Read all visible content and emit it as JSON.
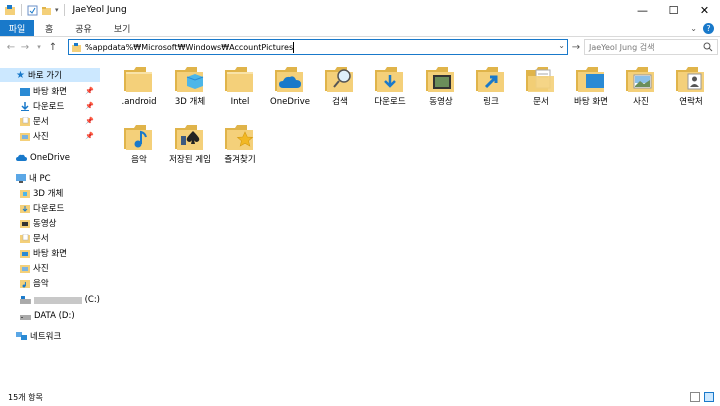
{
  "window": {
    "title": "JaeYeol Jung",
    "minimize": "—",
    "maximize": "☐",
    "close": "✕"
  },
  "ribbon": {
    "tabs": [
      "파일",
      "홈",
      "공유",
      "보기"
    ]
  },
  "address": {
    "path": "%appdata%₩Microsoft₩Windows₩AccountPictures",
    "search_placeholder": "JaeYeol Jung 검색"
  },
  "nav": {
    "quick_access": "바로 가기",
    "quick_items": [
      "바탕 화면",
      "다운로드",
      "문서",
      "사진"
    ],
    "onedrive": "OneDrive",
    "this_pc": "내 PC",
    "pc_items": [
      "3D 개체",
      "다운로드",
      "동영상",
      "문서",
      "바탕 화면",
      "사진",
      "음악"
    ],
    "drive_c": "(C:)",
    "drive_d": "DATA (D:)",
    "network": "네트워크"
  },
  "files": [
    {
      "name": ".android",
      "icon": "folder"
    },
    {
      "name": "3D 개체",
      "icon": "folder-3d"
    },
    {
      "name": "Intel",
      "icon": "folder"
    },
    {
      "name": "OneDrive",
      "icon": "onedrive-folder"
    },
    {
      "name": "검색",
      "icon": "search-folder"
    },
    {
      "name": "다운로드",
      "icon": "downloads-folder"
    },
    {
      "name": "동영상",
      "icon": "videos-folder"
    },
    {
      "name": "링크",
      "icon": "links-folder"
    },
    {
      "name": "문서",
      "icon": "documents-folder"
    },
    {
      "name": "바탕 화면",
      "icon": "desktop-folder"
    },
    {
      "name": "사진",
      "icon": "pictures-folder"
    },
    {
      "name": "연락처",
      "icon": "contacts-folder"
    },
    {
      "name": "음악",
      "icon": "music-folder"
    },
    {
      "name": "저장된 게임",
      "icon": "saved-games-folder"
    },
    {
      "name": "즐겨찾기",
      "icon": "favorites-folder"
    }
  ],
  "status": {
    "count": "15개 항목"
  },
  "colors": {
    "accent": "#1979ca",
    "folder": "#f4d07a",
    "folder_dark": "#e0b44a",
    "selection": "#cce8ff"
  }
}
